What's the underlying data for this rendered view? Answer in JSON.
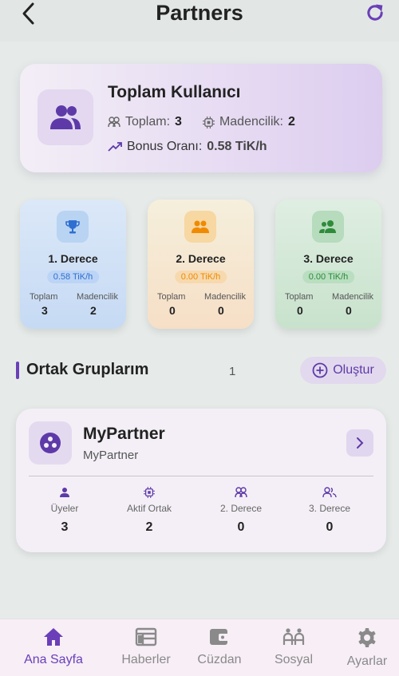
{
  "header": {
    "title": "Partners"
  },
  "summary": {
    "title": "Toplam Kullanıcı",
    "total_label": "Toplam:",
    "total_value": "3",
    "miner_label": "Madencilik:",
    "miner_value": "2",
    "bonus_label": "Bonus Oranı:",
    "bonus_value": "0.58 TiK/h"
  },
  "tiers": [
    {
      "title": "1. Derece",
      "rate": "0.58 TiK/h",
      "total_label": "Toplam",
      "total": "3",
      "miner_label": "Madencilik",
      "miners": "2"
    },
    {
      "title": "2. Derece",
      "rate": "0.00 TiK/h",
      "total_label": "Toplam",
      "total": "0",
      "miner_label": "Madencilik",
      "miners": "0"
    },
    {
      "title": "3. Derece",
      "rate": "0.00 TiK/h",
      "total_label": "Toplam",
      "total": "0",
      "miner_label": "Madencilik",
      "miners": "0"
    }
  ],
  "groups_section": {
    "title": "Ortak Gruplarım",
    "count": "1",
    "create_label": "Oluştur"
  },
  "group": {
    "name": "MyPartner",
    "subtitle": "MyPartner",
    "stats": [
      {
        "label": "Üyeler",
        "value": "3"
      },
      {
        "label": "Aktif Ortak",
        "value": "2"
      },
      {
        "label": "2. Derece",
        "value": "0"
      },
      {
        "label": "3. Derece",
        "value": "0"
      }
    ]
  },
  "nav": [
    {
      "label": "Ana Sayfa",
      "icon": "home-icon",
      "active": true
    },
    {
      "label": "Haberler",
      "icon": "news-icon",
      "active": false
    },
    {
      "label": "Cüzdan",
      "icon": "wallet-icon",
      "active": false
    },
    {
      "label": "Sosyal",
      "icon": "social-icon",
      "active": false
    },
    {
      "label": "Ayarlar",
      "icon": "settings-icon",
      "active": false
    }
  ],
  "colors": {
    "accent": "#6a3fb8",
    "tier1": "#2e6fd0",
    "tier2": "#f08a00",
    "tier3": "#2e8b3a"
  }
}
